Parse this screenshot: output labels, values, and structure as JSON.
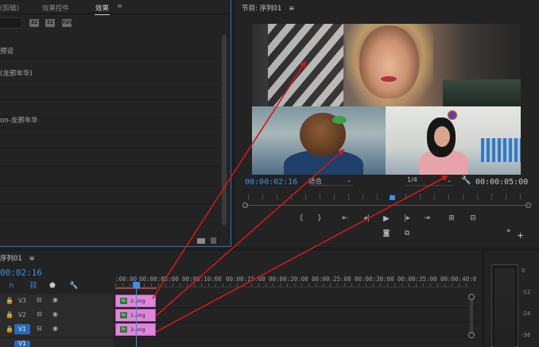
{
  "left_panel": {
    "tabs": [
      "(剪辑)",
      "效果控件",
      "效果"
    ],
    "menu_icon": "hamburger-icon",
    "toolbar_buttons": [
      "32",
      "32",
      "YUV"
    ],
    "tree_items": [
      "预设",
      "(龙邪年华)",
      "on-龙邪年华"
    ]
  },
  "program_monitor": {
    "title": "节目: 序列01",
    "menu_icon": "hamburger-icon",
    "timecode_current": "00:00:02:16",
    "fit_value": "适合",
    "resolution_value": "1/4",
    "timecode_duration": "00:00:05:00",
    "controls": [
      "mark-in-icon",
      "mark-out-icon",
      "go-to-in-icon",
      "step-back-icon",
      "play-icon",
      "step-forward-icon",
      "go-to-out-icon",
      "lift-icon",
      "extract-icon"
    ],
    "secondary_controls": [
      "export-frame-icon",
      "comparison-view-icon"
    ],
    "overflow_icon": "chevron-double-right-icon",
    "add_button": "+"
  },
  "timeline": {
    "title": "序列01",
    "menu_icon": "hamburger-icon",
    "timecode": "00:02:16",
    "ruler_labels": [
      ":00:00",
      "00:00:05:00",
      "00:00:10:00",
      "00:00:15:00",
      "00:00:20:00",
      "00:00:25:00",
      "00:00:30:00",
      "00:00:35:00",
      "00:00:40:0"
    ],
    "tracks": [
      {
        "name": "V3",
        "clip": "2.png",
        "highlighted": false
      },
      {
        "name": "V2",
        "clip": "1.png",
        "highlighted": false
      },
      {
        "name": "V1",
        "clip": "3.png",
        "highlighted": true
      }
    ],
    "partial_track": "V1"
  },
  "audio_meter": {
    "db_labels": [
      "0",
      "-12",
      "-24",
      "-36"
    ]
  },
  "colors": {
    "accent_blue": "#3d8ee6",
    "clip_pink": "#dc88da",
    "arrow_red": "#d01818"
  }
}
